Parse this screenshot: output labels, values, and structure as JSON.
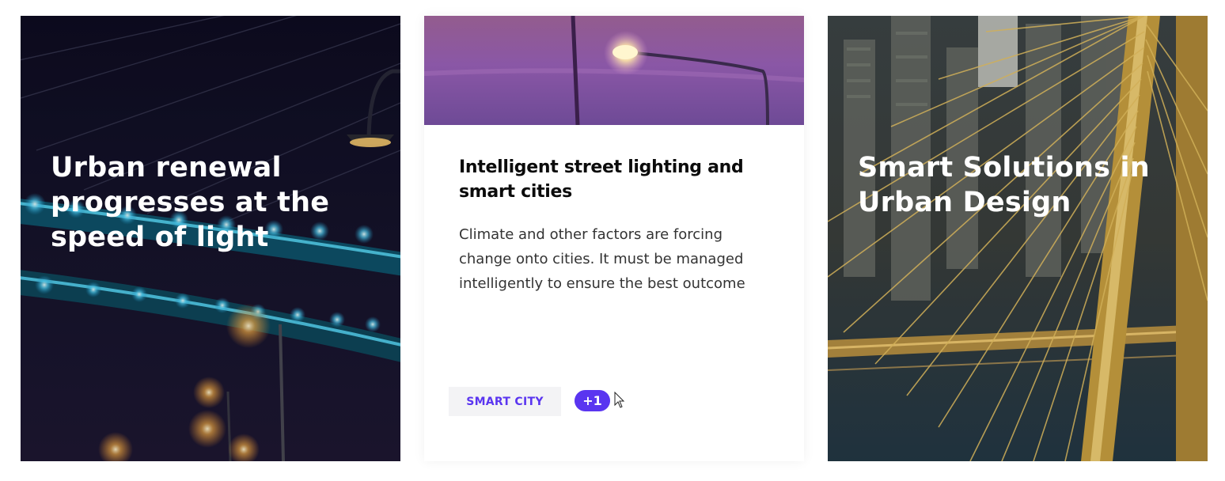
{
  "cards": [
    {
      "title": "Urban renewal progresses at the speed of light",
      "image": "night bridge with street lights"
    },
    {
      "image": "purple dusk street lamp",
      "title": "Intelligent street lighting and smart cities",
      "description": "Climate and other factors are forcing change onto cities. It must be managed intelligently to ensure the best outcome",
      "tag": "SMART CITY",
      "more_tags": "+1"
    },
    {
      "title": "Smart Solutions in Urban Design",
      "image": "golden cable-stayed bridge over city"
    }
  ],
  "colors": {
    "accent": "#5a35f0",
    "tag_bg": "#f3f3f5"
  }
}
